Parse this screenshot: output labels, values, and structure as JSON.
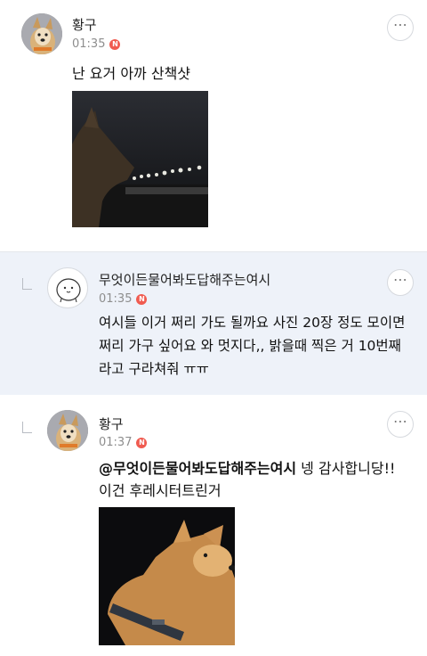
{
  "comments": [
    {
      "author": "황구",
      "time": "01:35",
      "badge": "N",
      "text": "난 요거 아까 산책샷",
      "more": "⋯"
    },
    {
      "author": "무엇이든물어봐도답해주는여시",
      "time": "01:35",
      "badge": "N",
      "text": "여시들 이거 쩌리 가도 될까요 사진 20장 정도 모이면 쩌리 가구 싶어요 와 멋지다,, 밝을때 찍은 거 10번째라고 구라쳐줘 ㅠㅠ",
      "more": "⋯"
    },
    {
      "author": "황구",
      "time": "01:37",
      "badge": "N",
      "mention": "@무엇이든물어봐도답해주는여시",
      "text_line1": " 넹 감사합니당!!",
      "text_line2": "이건 후레시터트린거",
      "more": "⋯"
    }
  ]
}
